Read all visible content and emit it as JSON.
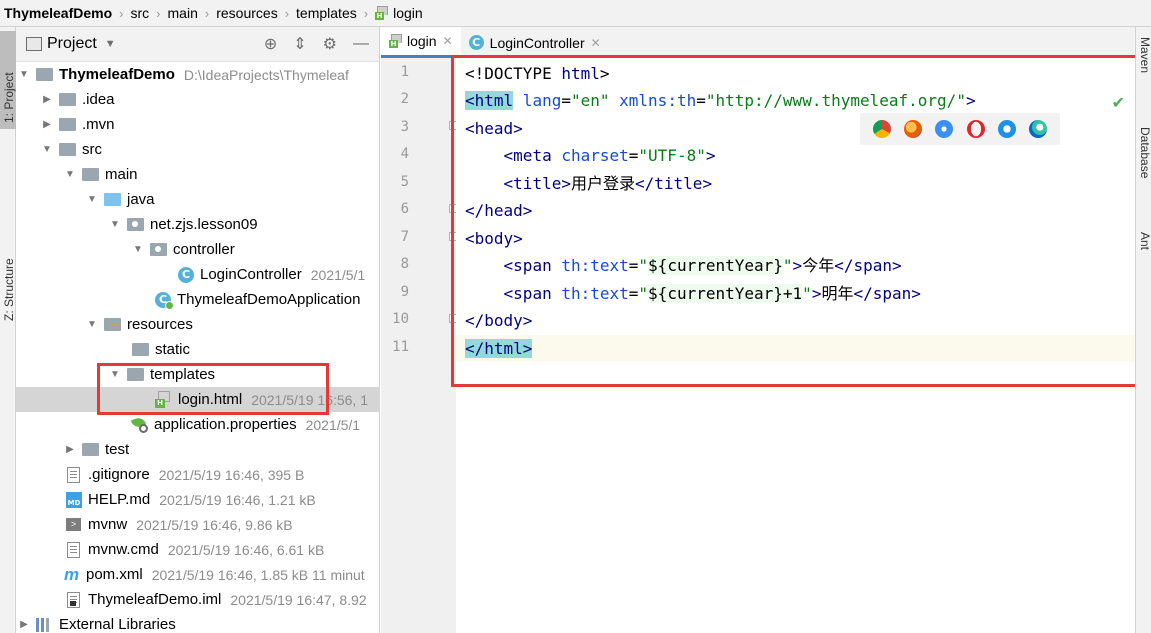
{
  "breadcrumb": {
    "items": [
      "ThymeleafDemo",
      "src",
      "main",
      "resources",
      "templates",
      "login"
    ]
  },
  "left_strip": {
    "project_tab": "1: Project",
    "structure_tab": "Z: Structure"
  },
  "project_panel": {
    "title": "Project",
    "tree": [
      {
        "label": "ThymeleafDemo",
        "meta": "D:\\IdeaProjects\\Thymeleaf"
      },
      {
        "label": ".idea",
        "meta": ""
      },
      {
        "label": ".mvn",
        "meta": ""
      },
      {
        "label": "src",
        "meta": ""
      },
      {
        "label": "main",
        "meta": ""
      },
      {
        "label": "java",
        "meta": ""
      },
      {
        "label": "net.zjs.lesson09",
        "meta": ""
      },
      {
        "label": "controller",
        "meta": ""
      },
      {
        "label": "LoginController",
        "meta": "2021/5/1"
      },
      {
        "label": "ThymeleafDemoApplication",
        "meta": ""
      },
      {
        "label": "resources",
        "meta": ""
      },
      {
        "label": "static",
        "meta": ""
      },
      {
        "label": "templates",
        "meta": ""
      },
      {
        "label": "login.html",
        "meta": "2021/5/19 16:56, 1"
      },
      {
        "label": "application.properties",
        "meta": "2021/5/1"
      },
      {
        "label": "test",
        "meta": ""
      },
      {
        "label": ".gitignore",
        "meta": "2021/5/19 16:46, 395 B"
      },
      {
        "label": "HELP.md",
        "meta": "2021/5/19 16:46, 1.21 kB"
      },
      {
        "label": "mvnw",
        "meta": "2021/5/19 16:46, 9.86 kB"
      },
      {
        "label": "mvnw.cmd",
        "meta": "2021/5/19 16:46, 6.61 kB"
      },
      {
        "label": "pom.xml",
        "meta": "2021/5/19 16:46, 1.85 kB 11 minut"
      },
      {
        "label": "ThymeleafDemo.iml",
        "meta": "2021/5/19 16:47, 8.92"
      },
      {
        "label": "External Libraries",
        "meta": ""
      }
    ]
  },
  "editor": {
    "tabs": [
      {
        "label": "login",
        "active": true
      },
      {
        "label": "LoginController",
        "active": false
      }
    ],
    "line_numbers": [
      "1",
      "2",
      "3",
      "4",
      "5",
      "6",
      "7",
      "8",
      "9",
      "10",
      "11"
    ],
    "code": {
      "l1_a": "<!DOCTYPE ",
      "l1_b": "html",
      "l1_c": ">",
      "l2_a": "<",
      "l2_b": "html",
      "l2_c": " lang",
      "l2_d": "=",
      "l2_e": "\"en\"",
      "l2_f": " xmlns:th",
      "l2_g": "=",
      "l2_h": "\"http://www.thymeleaf.org/\"",
      "l2_i": ">",
      "l3_a": "<",
      "l3_b": "head",
      "l3_c": ">",
      "l4_a": "    <",
      "l4_b": "meta",
      "l4_c": " charset",
      "l4_d": "=",
      "l4_e": "\"UTF-8\"",
      "l4_f": ">",
      "l5_a": "    <",
      "l5_b": "title",
      "l5_c": ">",
      "l5_d": "用户登录",
      "l5_e": "</",
      "l5_f": "title",
      "l5_g": ">",
      "l6_a": "</",
      "l6_b": "head",
      "l6_c": ">",
      "l7_a": "<",
      "l7_b": "body",
      "l7_c": ">",
      "l8_a": "    <",
      "l8_b": "span",
      "l8_c": " th:text",
      "l8_d": "=",
      "l8_e": "\"",
      "l8_f": "${currentYear}",
      "l8_g": "\"",
      "l8_h": ">",
      "l8_i": "今年",
      "l8_j": "</",
      "l8_k": "span",
      "l8_l": ">",
      "l9_a": "    <",
      "l9_b": "span",
      "l9_c": " th:text",
      "l9_d": "=",
      "l9_e": "\"",
      "l9_f": "${currentYear}+1",
      "l9_g": "\"",
      "l9_h": ">",
      "l9_i": "明年",
      "l9_j": "</",
      "l9_k": "span",
      "l9_l": ">",
      "l10_a": "</",
      "l10_b": "body",
      "l10_c": ">",
      "l11_a": "</",
      "l11_b": "html",
      "l11_c": ">"
    },
    "browser_icons": [
      "chrome-icon",
      "firefox-icon",
      "safari-icon",
      "opera-icon",
      "ie-icon",
      "edge-icon"
    ]
  },
  "right_strip": {
    "tabs": [
      "Maven",
      "Database",
      "Ant"
    ]
  },
  "colors": {
    "highlight_box": "#e53935",
    "tag": "#000080",
    "attr": "#174ad4",
    "string": "#067d17"
  }
}
